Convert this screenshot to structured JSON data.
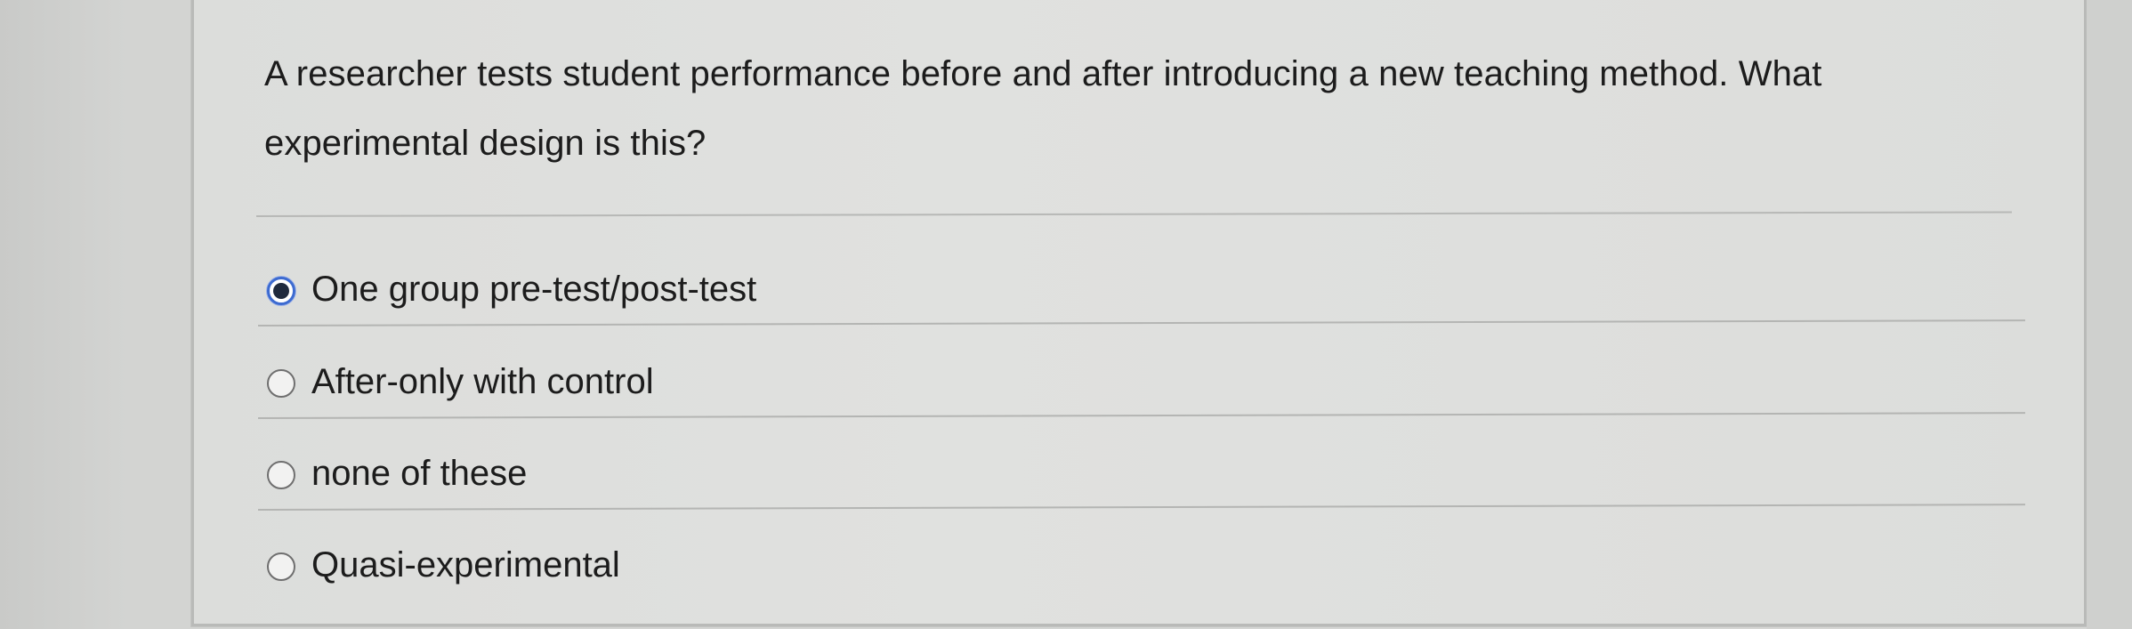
{
  "question": {
    "text": "A researcher tests student performance before and after introducing a new teaching method. What experimental design is this?"
  },
  "options": [
    {
      "label": "One group pre-test/post-test",
      "selected": true
    },
    {
      "label": "After-only with control",
      "selected": false
    },
    {
      "label": "none of these",
      "selected": false
    },
    {
      "label": "Quasi-experimental",
      "selected": false
    }
  ],
  "colors": {
    "selected_radio": "#3d6bd0",
    "text": "#1c1c1c"
  }
}
